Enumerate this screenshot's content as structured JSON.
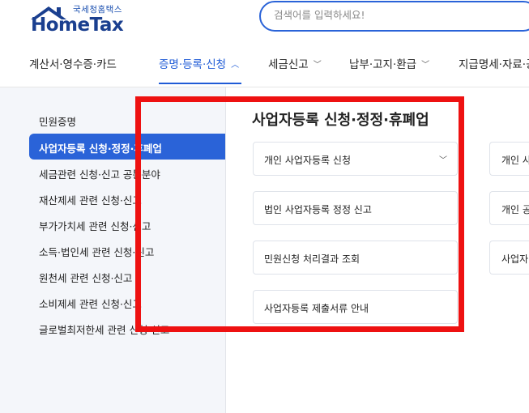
{
  "header": {
    "logo_top": "국세청홈택스",
    "logo_text": "HomeTax",
    "search_placeholder": "검색어를 입력하세요!"
  },
  "gnb": {
    "items": [
      {
        "label": "계산서·영수증·카드"
      },
      {
        "label": "증명·등록·신청"
      },
      {
        "label": "세금신고"
      },
      {
        "label": "납부·고지·환급"
      },
      {
        "label": "지급명세·자료·공"
      }
    ]
  },
  "sidebar": {
    "items": [
      {
        "label": "민원증명"
      },
      {
        "label": "사업자등록 신청·정정·휴폐업"
      },
      {
        "label": "세금관련 신청·신고 공통분야"
      },
      {
        "label": "재산제세 관련 신청·신고"
      },
      {
        "label": "부가가치세 관련 신청·신고"
      },
      {
        "label": "소득·법인세 관련 신청·신고"
      },
      {
        "label": "원천세 관련 신청·신고"
      },
      {
        "label": "소비제세 관련 신청·신고"
      },
      {
        "label": "글로벌최저한세 관련 신청·신고"
      }
    ]
  },
  "main": {
    "title": "사업자등록 신청·정정·휴폐업",
    "cards": [
      {
        "label": "개인 사업자등록 신청"
      },
      {
        "label": "법인 사업자등록 정정 신고"
      },
      {
        "label": "민원신청 처리결과 조회"
      },
      {
        "label": "사업자등록 제출서류 안내"
      }
    ],
    "cards_right": [
      {
        "label": "개인 사"
      },
      {
        "label": "개인 공"
      },
      {
        "label": "사업자"
      }
    ]
  },
  "colors": {
    "brand_blue": "#2a63d8",
    "highlight_red": "#ee1111"
  }
}
